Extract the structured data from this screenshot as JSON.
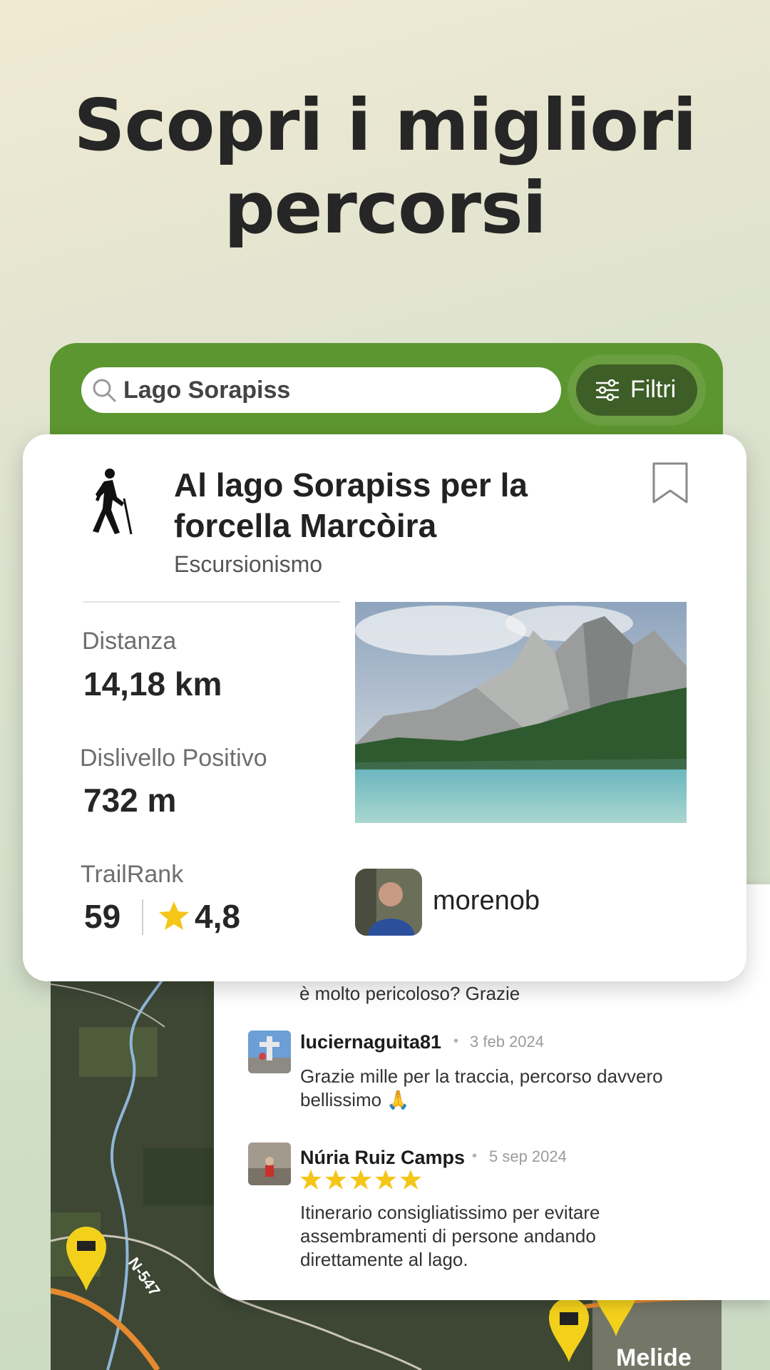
{
  "headline": {
    "line1": "Scopri i migliori",
    "line2": "percorsi"
  },
  "search": {
    "value": "Lago Sorapiss",
    "icon": "search-icon"
  },
  "filters": {
    "label": "Filtri",
    "icon": "sliders-icon"
  },
  "trail": {
    "activity_icon": "hiker-icon",
    "title": "Al lago Sorapiss per la forcella Marcòira",
    "activity": "Escursionismo",
    "bookmark_icon": "bookmark-icon",
    "stats": {
      "distance_label": "Distanza",
      "distance_value": "14,18 km",
      "elevation_label": "Dislivello Positivo",
      "elevation_value": "732 m",
      "trailrank_label": "TrailRank",
      "trailrank_value": "59",
      "rating_value": "4,8"
    },
    "photo": "lake-mountain-photo",
    "author": "morenob"
  },
  "comments": {
    "previous_tail": "è molto pericoloso? Grazie",
    "items": [
      {
        "user": "luciernaguita81",
        "date": "3 feb 2024",
        "text": "Grazie mille per la traccia, percorso davvero bellissimo 🙏"
      },
      {
        "user": "Núria Ruiz Camps",
        "date": "5 sep 2024",
        "rating": 5,
        "text": "Itinerario consigliatissimo per evitare assembramenti di persone andando direttamente al lago."
      }
    ]
  },
  "map": {
    "road_label": "N-547",
    "place_label": "Melide"
  },
  "colors": {
    "brand_green": "#5c9630",
    "filter_dark": "#3e5e27",
    "star_yellow": "#f5c518",
    "marker_yellow": "#f3d11b"
  }
}
